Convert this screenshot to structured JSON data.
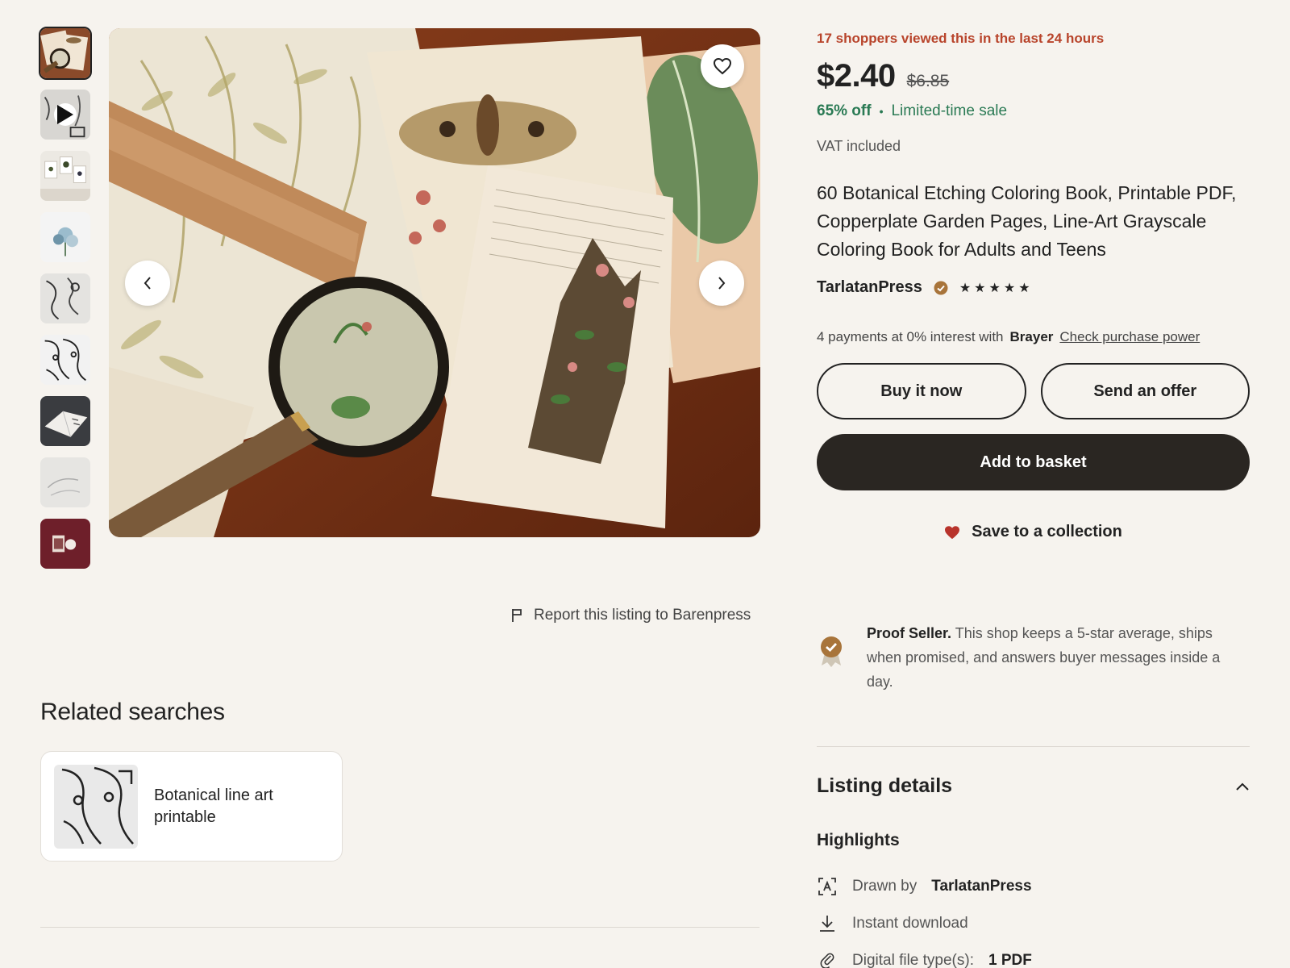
{
  "gallery": {
    "thumbnails": [
      {
        "alt": "product-photo"
      },
      {
        "alt": "product-video",
        "is_video": true
      },
      {
        "alt": "framed-prints"
      },
      {
        "alt": "blue-bouquet"
      },
      {
        "alt": "line-art-sketch"
      },
      {
        "alt": "face-line-art"
      },
      {
        "alt": "open-book"
      },
      {
        "alt": "pencil-sketch"
      },
      {
        "alt": "burgundy-card"
      }
    ],
    "selected_index": 0
  },
  "report": {
    "label": "Report this listing to Barenpress"
  },
  "related": {
    "title": "Related searches",
    "items": [
      {
        "label": "Botanical line art printable"
      }
    ]
  },
  "product": {
    "views_notice": "17 shoppers viewed this in the last 24 hours",
    "price": "$2.40",
    "original_price": "$6.85",
    "discount": "65% off",
    "sale_label": "Limited-time sale",
    "separator": "•",
    "vat": "VAT included",
    "title": "60 Botanical Etching Coloring Book, Printable PDF, Copperplate Garden Pages, Line-Art Grayscale Coloring Book for Adults and Teens",
    "shop_name": "TarlatanPress",
    "rating_stars": 5,
    "star_glyph": "★"
  },
  "payments": {
    "text": "4 payments at 0% interest with",
    "provider": "Brayer",
    "link": "Check purchase power"
  },
  "actions": {
    "buy_now": "Buy it now",
    "offer": "Send an offer",
    "add_to_basket": "Add to basket",
    "save": "Save to a collection"
  },
  "proof_seller": {
    "title": "Proof Seller.",
    "text": "This shop keeps a 5-star average, ships when promised, and answers buyer messages inside a day."
  },
  "listing_details": {
    "title": "Listing details",
    "highlights_title": "Highlights",
    "highlights": [
      {
        "icon": "drawn-by-icon",
        "label": "Drawn by",
        "value": "TarlatanPress"
      },
      {
        "icon": "download-icon",
        "label": "Instant download",
        "value": ""
      },
      {
        "icon": "paperclip-icon",
        "label": "Digital file type(s):",
        "value": "1 PDF"
      }
    ]
  },
  "colors": {
    "background": "#f6f3ee",
    "alert": "#b8442b",
    "sale": "#2a7a54",
    "primary_button": "#2a2622",
    "heart": "#b8332b",
    "medal": "#a8743a"
  }
}
